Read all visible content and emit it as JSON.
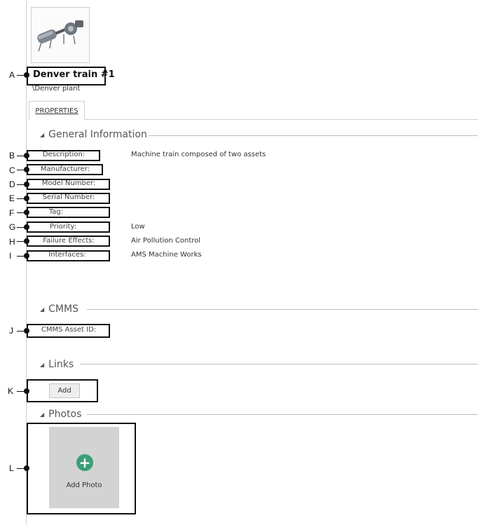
{
  "asset": {
    "title": "Denver train #1",
    "path": "\\Denver plant",
    "image_icon": "machine-train-icon"
  },
  "tabs": [
    {
      "label": "PROPERTIES"
    }
  ],
  "sections": {
    "general": {
      "title": "General Information",
      "collapse_icon": "collapse-triangle-icon"
    },
    "cmms": {
      "title": "CMMS"
    },
    "links": {
      "title": "Links"
    },
    "photos": {
      "title": "Photos"
    }
  },
  "fields": [
    {
      "label": "Description:",
      "value": "Machine train composed of two assets"
    },
    {
      "label": "Manufacturer:",
      "value": ""
    },
    {
      "label": "Model Number:",
      "value": ""
    },
    {
      "label": "Serial Number:",
      "value": ""
    },
    {
      "label": "Tag:",
      "value": ""
    },
    {
      "label": "Priority:",
      "value": "Low"
    },
    {
      "label": "Failure Effects:",
      "value": "Air Pollution Control"
    },
    {
      "label": "Interfaces:",
      "value": "AMS Machine Works"
    }
  ],
  "cmms_fields": [
    {
      "label": "CMMS Asset ID:",
      "value": ""
    }
  ],
  "links": {
    "add_label": "Add"
  },
  "photos": {
    "add_label": "Add Photo",
    "add_icon": "plus-circle-icon",
    "accent_color": "#3a9f79"
  },
  "callouts": [
    "A",
    "B",
    "C",
    "D",
    "E",
    "F",
    "G",
    "H",
    "I",
    "J",
    "K",
    "L"
  ]
}
